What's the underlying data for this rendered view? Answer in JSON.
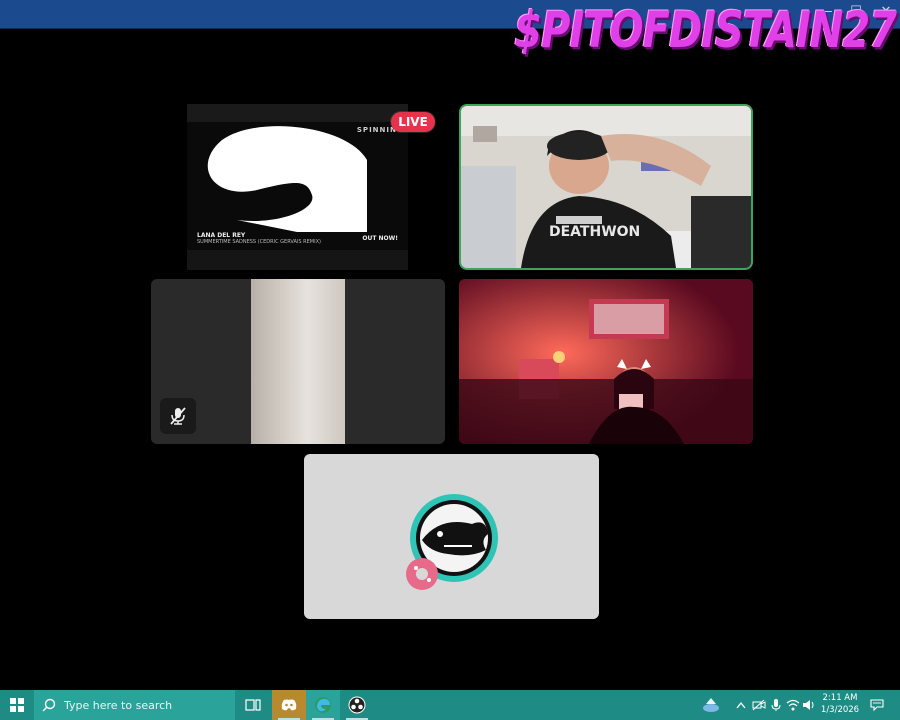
{
  "window": {
    "controls": [
      "—",
      "☐",
      "✕"
    ]
  },
  "watermark": {
    "text": "$PITOFDISTAIN27",
    "color": "#e040e8"
  },
  "tiles": {
    "video": {
      "brand": "SPINNIN'",
      "live_label": "LIVE",
      "artist": "LANA DEL REY",
      "song": "SUMMERTIME SADNESS (CEDRIC GERVAIS REMIX)",
      "out_now": "OUT NOW!",
      "live_color": "#e5334b"
    },
    "cam1": {
      "shirt_text": "DEATHWON",
      "speaking_border_color": "#3aa55d"
    },
    "cam2": {
      "muted": true
    },
    "cam3": {},
    "avatar": {}
  },
  "taskbar": {
    "search_placeholder": "Type here to search",
    "apps": [
      "task-view",
      "discord",
      "edge",
      "obs"
    ],
    "clock_time": "2:11 AM",
    "clock_date": "1/3/2026",
    "color": "#1e8c85"
  }
}
